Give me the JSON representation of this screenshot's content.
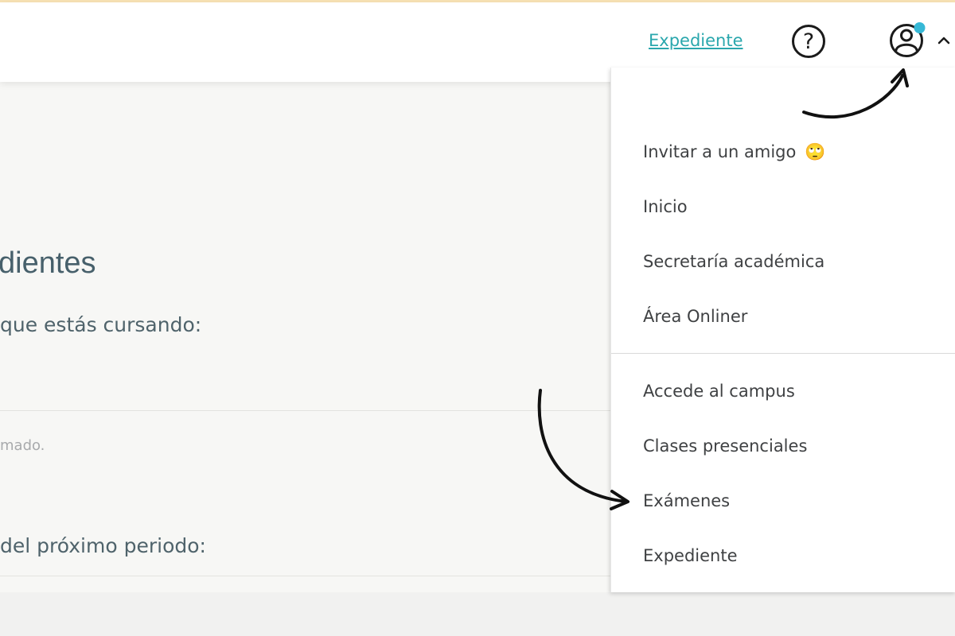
{
  "header": {
    "record_link": "Expediente",
    "help_icon": "question-circle-icon",
    "user_icon": "user-circle-icon",
    "chevron_icon": "chevron-up-icon",
    "notification_dot_color": "#36b8d6"
  },
  "main": {
    "title_fragment": "dientes",
    "current_text": "que estás cursando:",
    "note_text": "mado.",
    "next_period_text": "del próximo periodo:"
  },
  "menu": {
    "items": [
      {
        "label": "Invitar a un amigo",
        "emoji": "🙄"
      },
      {
        "label": "Inicio"
      },
      {
        "label": "Secretaría académica"
      },
      {
        "label": "Área Onliner"
      },
      {
        "label": "Accede al campus"
      },
      {
        "label": "Clases presenciales"
      },
      {
        "label": "Exámenes"
      },
      {
        "label": "Expediente"
      }
    ]
  }
}
